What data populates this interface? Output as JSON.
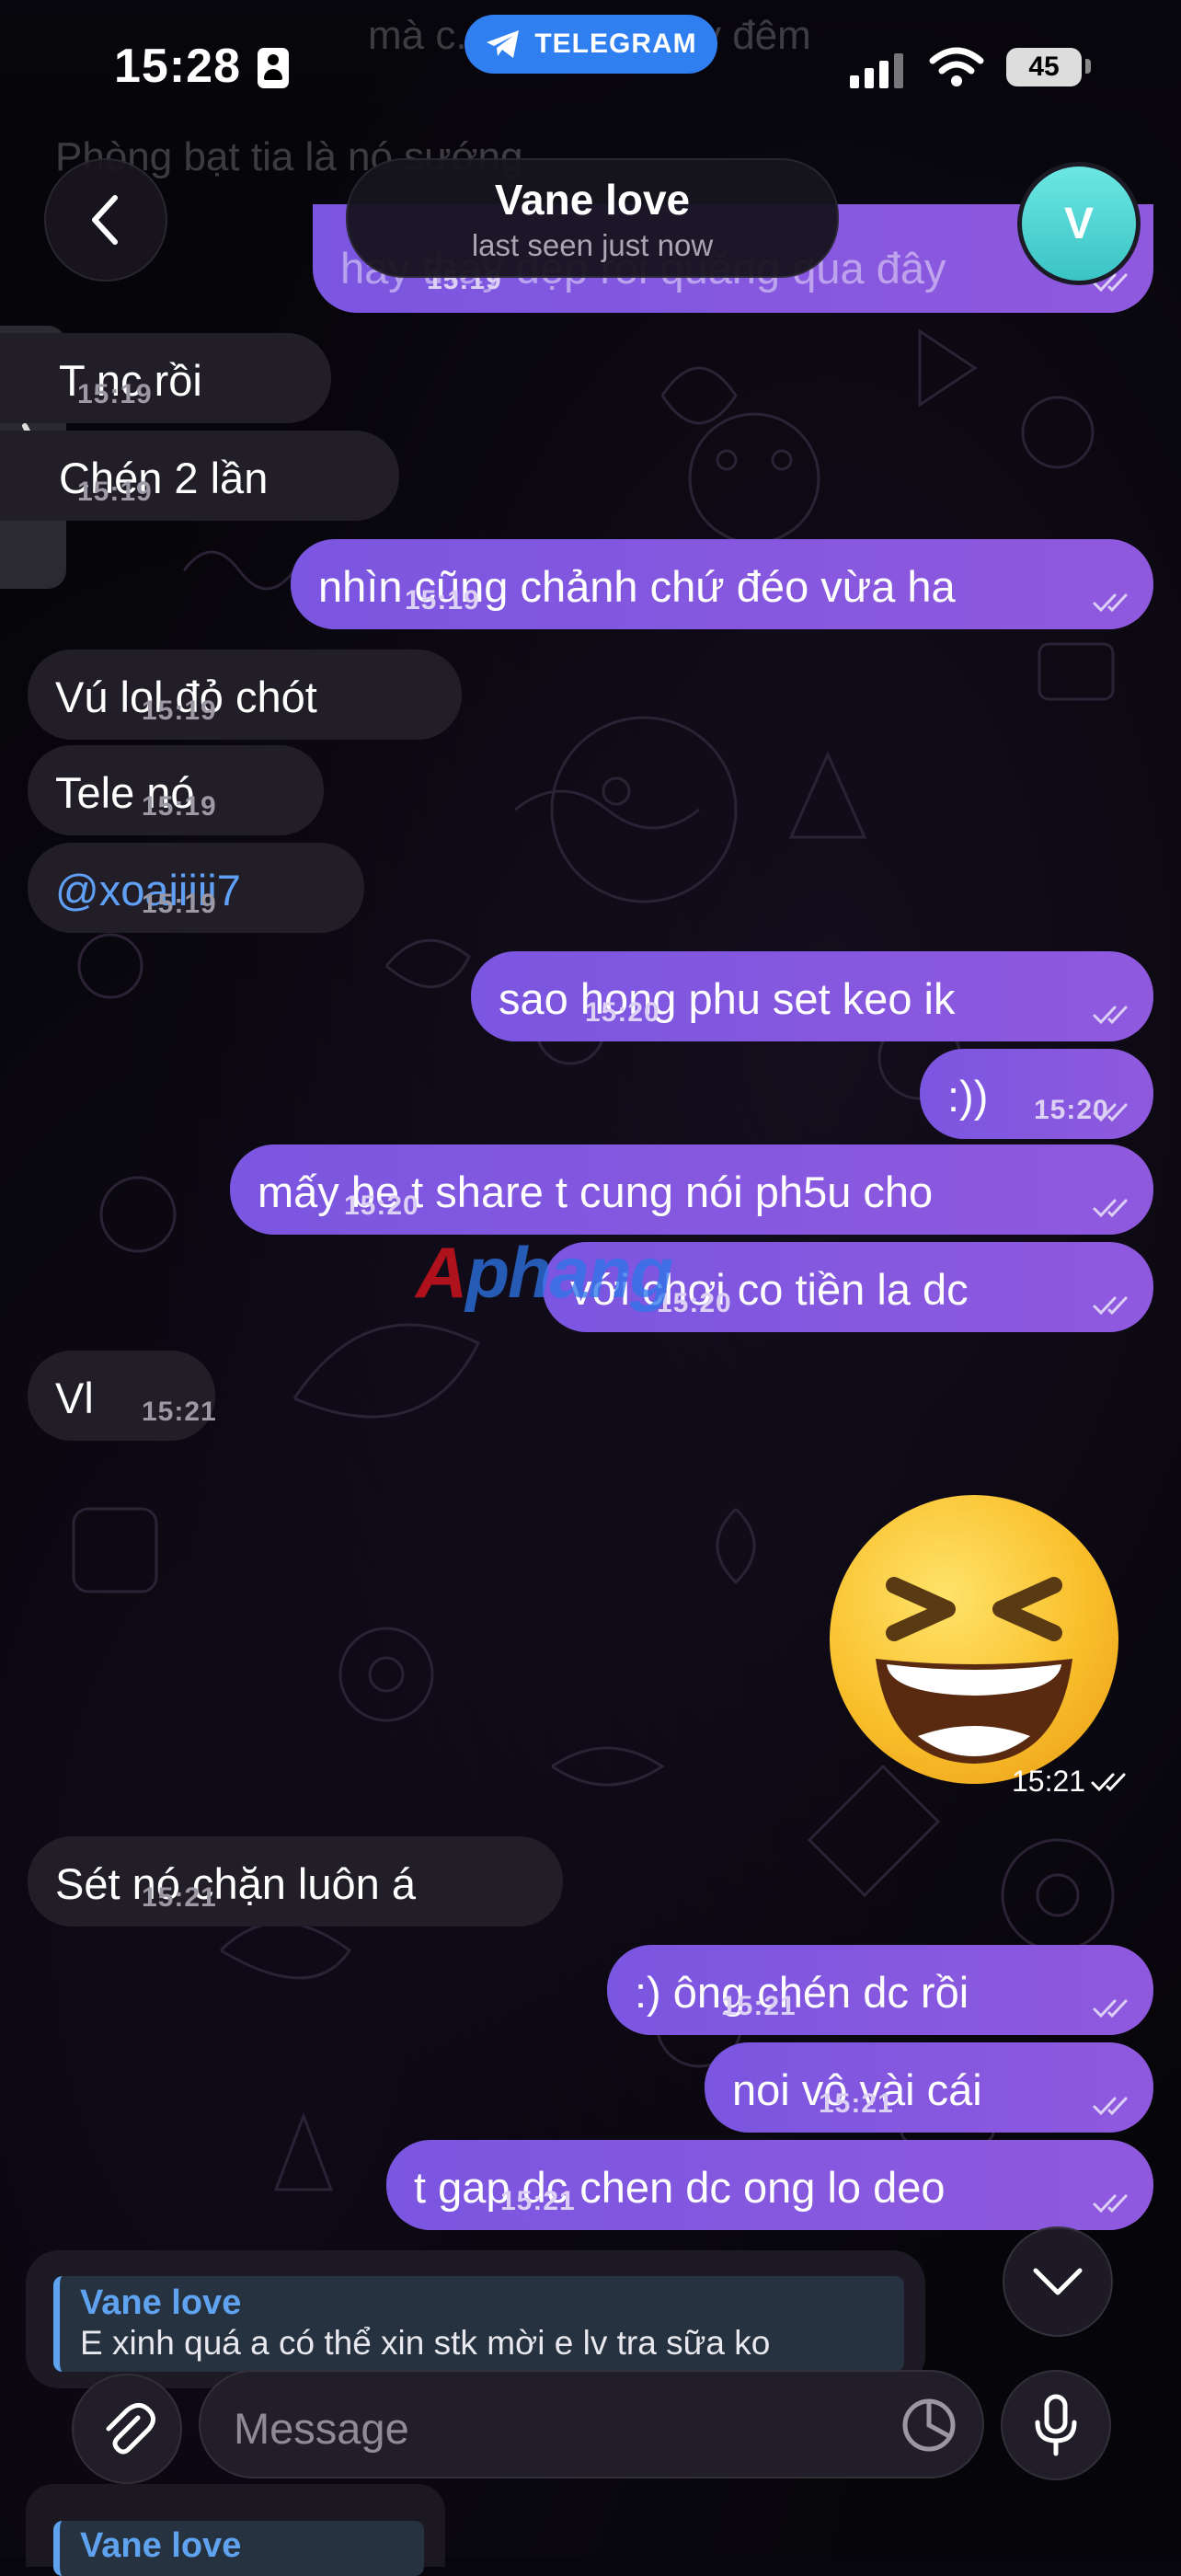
{
  "status_bar": {
    "time": "15:28",
    "app_pill": "TELEGRAM",
    "battery": "45"
  },
  "header": {
    "title": "Vane love",
    "subtitle": "last seen just now",
    "avatar_letter": "V"
  },
  "partial_messages": {
    "top_ghost_1": "mà c... ...sống ngày đêm",
    "top_ghost_2": "Phòng bạt tia là nó sướng",
    "top_out_text": "hay thay đẹp rồi quăng qua đây",
    "top_out_time": "15:19"
  },
  "messages": [
    {
      "dir": "in",
      "text": "T nc rồi",
      "time": "15:19"
    },
    {
      "dir": "in",
      "text": "Chén 2 lần",
      "time": "15:19"
    },
    {
      "dir": "out",
      "text": "nhìn cũng chảnh chứ đéo vừa ha",
      "time": "15:19"
    },
    {
      "dir": "in",
      "text": "Vú lol đỏ chót",
      "time": "15:19"
    },
    {
      "dir": "in",
      "text": "Tele nó",
      "time": "15:19"
    },
    {
      "dir": "in",
      "text": "@xoaiiiii7",
      "time": "15:19"
    },
    {
      "dir": "out",
      "text": "sao hong phu set keo ik",
      "time": "15:20"
    },
    {
      "dir": "out",
      "text": ":))",
      "time": "15:20"
    },
    {
      "dir": "out",
      "text": "mấy be t share t cung nói ph5u cho",
      "time": "15:20"
    },
    {
      "dir": "out",
      "text": "với chơi co tiền la dc",
      "time": "15:20"
    },
    {
      "dir": "in",
      "text": "Vl",
      "time": "15:21"
    },
    {
      "dir": "out",
      "text": "😆",
      "time": "15:21"
    },
    {
      "dir": "in",
      "text": "Sét nó chặn luôn á",
      "time": "15:21"
    },
    {
      "dir": "out",
      "text": ":) ông chén dc rồi",
      "time": "15:21"
    },
    {
      "dir": "out",
      "text": "noi vô vài cái",
      "time": "15:21"
    },
    {
      "dir": "out",
      "text": "t gap dc chen dc ong lo deo",
      "time": "15:21"
    }
  ],
  "reply_preview": {
    "name": "Vane love",
    "text": "E xinh quá a có thể xin stk mời e lv tra sữa ko"
  },
  "next_reply_preview": {
    "name": "Vane love"
  },
  "composer": {
    "placeholder": "Message"
  },
  "watermark": {
    "first": "A",
    "rest": "phang"
  },
  "colors": {
    "outgoing_bubble": "#8158e0",
    "incoming_bubble": "#221e27",
    "mention": "#5f9ff5",
    "telegram_pill": "#2f7ff0",
    "avatar": "#4fd3d1"
  }
}
